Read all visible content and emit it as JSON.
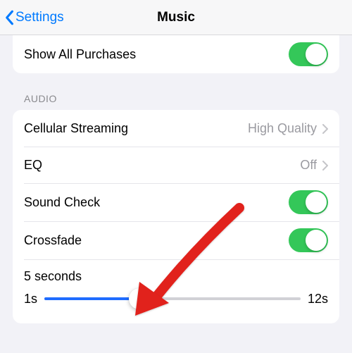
{
  "nav": {
    "back_label": "Settings",
    "title": "Music"
  },
  "top_group": {
    "show_all_purchases_label": "Show All Purchases",
    "show_all_purchases_on": true
  },
  "audio": {
    "section_title": "Audio",
    "cellular_streaming": {
      "label": "Cellular Streaming",
      "value": "High Quality"
    },
    "eq": {
      "label": "EQ",
      "value": "Off"
    },
    "sound_check": {
      "label": "Sound Check",
      "on": true
    },
    "crossfade": {
      "label": "Crossfade",
      "on": true
    },
    "slider": {
      "value_label": "5 seconds",
      "min_label": "1s",
      "max_label": "12s",
      "percent": 37
    }
  }
}
